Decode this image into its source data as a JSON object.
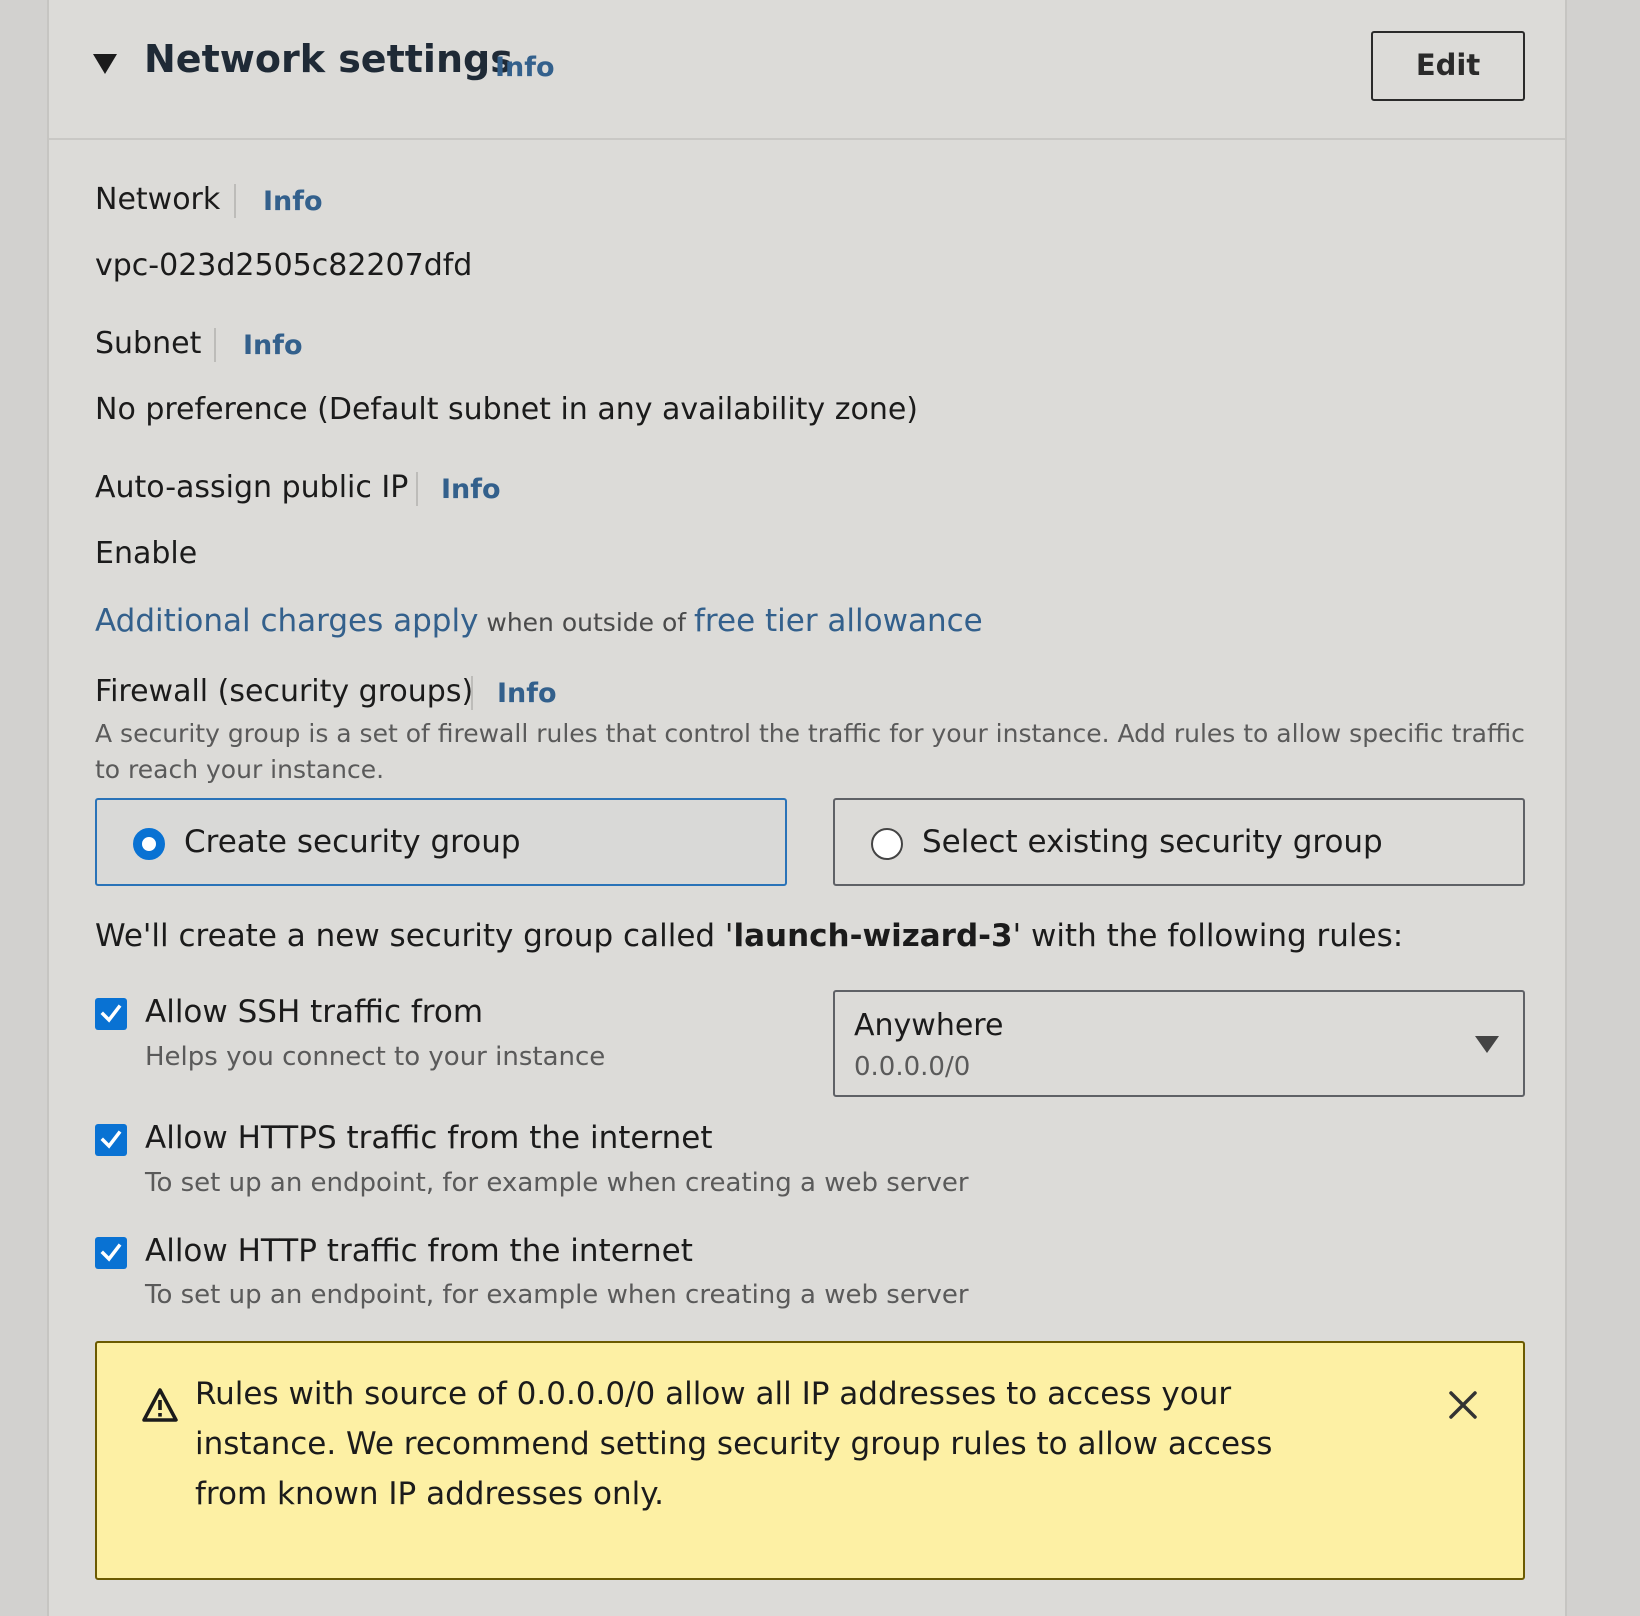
{
  "header": {
    "title": "Network settings",
    "info": "Info",
    "edit": "Edit"
  },
  "network": {
    "label": "Network",
    "info": "Info",
    "value": "vpc-023d2505c82207dfd"
  },
  "subnet": {
    "label": "Subnet",
    "info": "Info",
    "value": "No preference (Default subnet in any availability zone)"
  },
  "auto_ip": {
    "label": "Auto-assign public IP",
    "info": "Info",
    "value": "Enable"
  },
  "charges": {
    "link1": "Additional charges apply",
    "middle": " when outside of ",
    "link2": "free tier allowance"
  },
  "firewall": {
    "label": "Firewall (security groups)",
    "info": "Info",
    "description": "A security group is a set of firewall rules that control the traffic for your instance. Add rules to allow specific traffic to reach your instance.",
    "options": [
      {
        "label": "Create security group",
        "selected": true
      },
      {
        "label": "Select existing security group",
        "selected": false
      }
    ]
  },
  "create_note": {
    "prefix": "We'll create a new security group called '",
    "name": "launch-wizard-3",
    "suffix": "' with the following rules:"
  },
  "rules": [
    {
      "label": "Allow SSH traffic from",
      "desc": "Helps you connect to your instance",
      "checked": true
    },
    {
      "label": "Allow HTTPS traffic from the internet",
      "desc": "To set up an endpoint, for example when creating a web server",
      "checked": true
    },
    {
      "label": "Allow HTTP traffic from the internet",
      "desc": "To set up an endpoint, for example when creating a web server",
      "checked": true
    }
  ],
  "ssh_source": {
    "value": "Anywhere",
    "sub": "0.0.0.0/0"
  },
  "alert": {
    "text": "Rules with source of 0.0.0.0/0 allow all IP addresses to access your instance. We recommend setting security group rules to allow access from known IP addresses only."
  },
  "colors": {
    "accent": "#0972d3",
    "link": "#33608c",
    "warning_bg": "#fdf0a4"
  },
  "icons": [
    "caret-down-icon",
    "radio-icon",
    "check-icon",
    "chevron-down-icon",
    "warning-icon",
    "close-icon"
  ]
}
